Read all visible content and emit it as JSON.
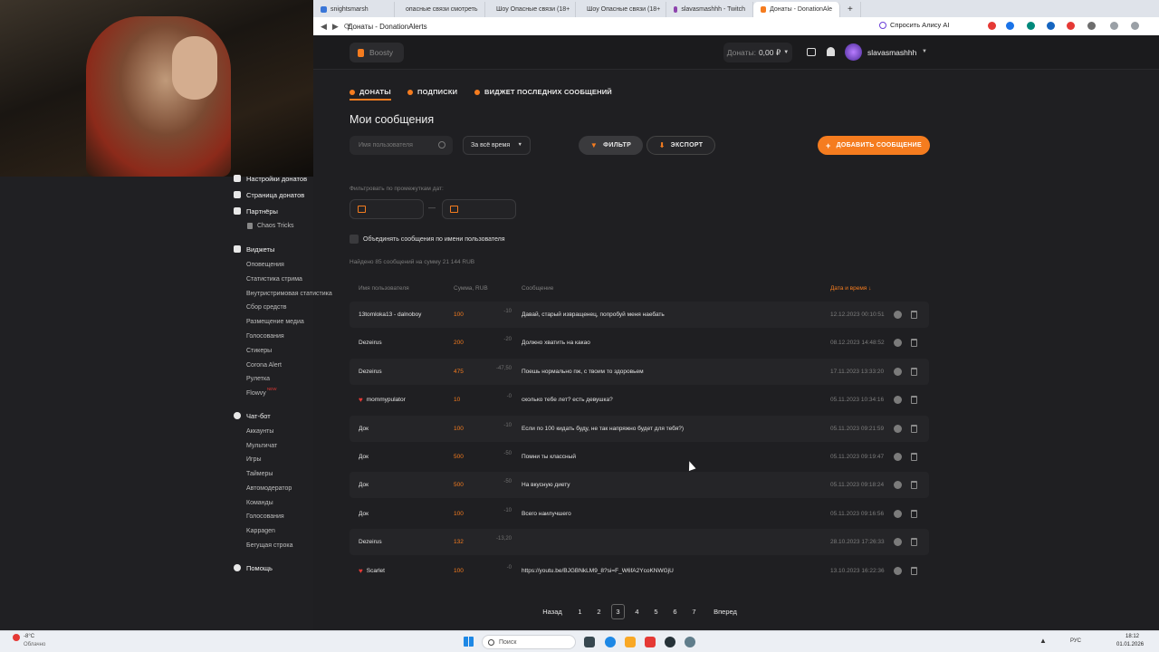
{
  "browser": {
    "tabs": [
      {
        "label": "snightsmarsh",
        "color": "#3a76d8",
        "active": false
      },
      {
        "label": "опасные связи смотреть",
        "color": "#e53935",
        "active": false
      },
      {
        "label": "Шоу Опасные связи (18+",
        "color": "#c2185b",
        "active": false
      },
      {
        "label": "Шоу Опасные связи (18+",
        "color": "#c2185b",
        "active": false
      },
      {
        "label": "slavasmashhh - Twitch",
        "color": "#8e44ad",
        "active": false
      },
      {
        "label": "Донаты - DonationAle",
        "color": "#f57c1f",
        "active": true
      }
    ],
    "address": "Донаты - DonationAlerts",
    "alice_label": "Спросить Алису AI"
  },
  "topbar": {
    "boosty_label": "Boosty",
    "donate_balance_label": "Донаты:",
    "donate_balance_value": "0,00 ₽",
    "username": "slavasmashhh"
  },
  "sidebar": {
    "settings": "Настройки донатов",
    "donate_page": "Страница донатов",
    "partners": "Партнёры",
    "chaos": "Chaos Tricks",
    "widgets": "Виджеты",
    "widget_items": [
      "Оповещения",
      "Статистика стрима",
      "Внутристримовая статистика",
      "Сбор средств",
      "Размещение медиа",
      "Голосования",
      "Стикеры",
      "Corona Alert",
      "Рулетка",
      "Flowvy"
    ],
    "flowvy_badge": "NEW",
    "chatbot": "Чат-бот",
    "chatbot_items": [
      "Аккаунты",
      "Мультичат",
      "Игры",
      "Таймеры",
      "Автомодератор",
      "Команды",
      "Голосования",
      "Kappagen",
      "Бегущая строка"
    ],
    "help": "Помощь"
  },
  "page_tabs": [
    "ДОНАТЫ",
    "ПОДПИСКИ",
    "ВИДЖЕТ ПОСЛЕДНИХ СООБЩЕНИЙ"
  ],
  "title": "Мои сообщения",
  "search_placeholder": "Имя пользователя",
  "period_select": "За всё время",
  "filter_btn": "ФИЛЬТР",
  "export_btn": "ЭКСПОРТ",
  "add_btn": "ДОБАВИТЬ СООБЩЕНИЕ",
  "date_filter_label": "Фильтровать по промежуткам дат:",
  "date_separator": "—",
  "merge_label": "Объединять сообщения по имени пользователя",
  "found_text": "Найдено 85 сообщений на сумму 21 144 RUB",
  "table": {
    "headers": [
      "Имя пользователя",
      "Сумма, RUB",
      "Сообщение",
      "Дата и время ↓"
    ],
    "rows": [
      {
        "user": "13tomloka13 - dalnoboy",
        "heart": false,
        "amount": "100",
        "fee": "-10",
        "message": "Давай, старый извращенец, попробуй меня наебать",
        "date": "12.12.2023 00:10:51"
      },
      {
        "user": "Dezeirus",
        "heart": false,
        "amount": "200",
        "fee": "-20",
        "message": "Должно хватить на какао",
        "date": "08.12.2023 14:48:52"
      },
      {
        "user": "Dezeirus",
        "heart": false,
        "amount": "475",
        "fee": "-47,50",
        "message": "Поешь нормально пж, с твоим то здоровьем",
        "date": "17.11.2023 13:33:20"
      },
      {
        "user": "mommypulator",
        "heart": true,
        "amount": "10",
        "fee": "-0",
        "message": "сколько тебе лет? есть девушка?",
        "date": "05.11.2023 10:34:16"
      },
      {
        "user": "Док",
        "heart": false,
        "amount": "100",
        "fee": "-10",
        "message": "Если по 100 кидать буду, не так напряжно будет для тебя?)",
        "date": "05.11.2023 09:21:59"
      },
      {
        "user": "Док",
        "heart": false,
        "amount": "500",
        "fee": "-50",
        "message": "Помни ты классный",
        "date": "05.11.2023 09:19:47"
      },
      {
        "user": "Док",
        "heart": false,
        "amount": "500",
        "fee": "-50",
        "message": "На вкусную диету",
        "date": "05.11.2023 09:18:24"
      },
      {
        "user": "Док",
        "heart": false,
        "amount": "100",
        "fee": "-10",
        "message": "Всего наилучшего",
        "date": "05.11.2023 09:16:56"
      },
      {
        "user": "Dezeirus",
        "heart": false,
        "amount": "132",
        "fee": "-13,20",
        "message": "",
        "date": "28.10.2023 17:26:33"
      },
      {
        "user": "Scarlet",
        "heart": true,
        "amount": "100",
        "fee": "-0",
        "message": "https://youtu.be/BJGBNkLM9_8?si=F_W6fA2YcoKNWGjU",
        "date": "13.10.2023 16:22:36"
      }
    ]
  },
  "pagination": {
    "prev": "Назад",
    "pages": [
      "1",
      "2",
      "3",
      "4",
      "5",
      "6",
      "7"
    ],
    "current": "3",
    "next": "Вперед"
  },
  "taskbar": {
    "weather_temp": "-8°C",
    "weather_desc": "Облачно",
    "search": "Поиск",
    "lang": "РУС",
    "time": "18:12",
    "date": "01.01.2026"
  }
}
